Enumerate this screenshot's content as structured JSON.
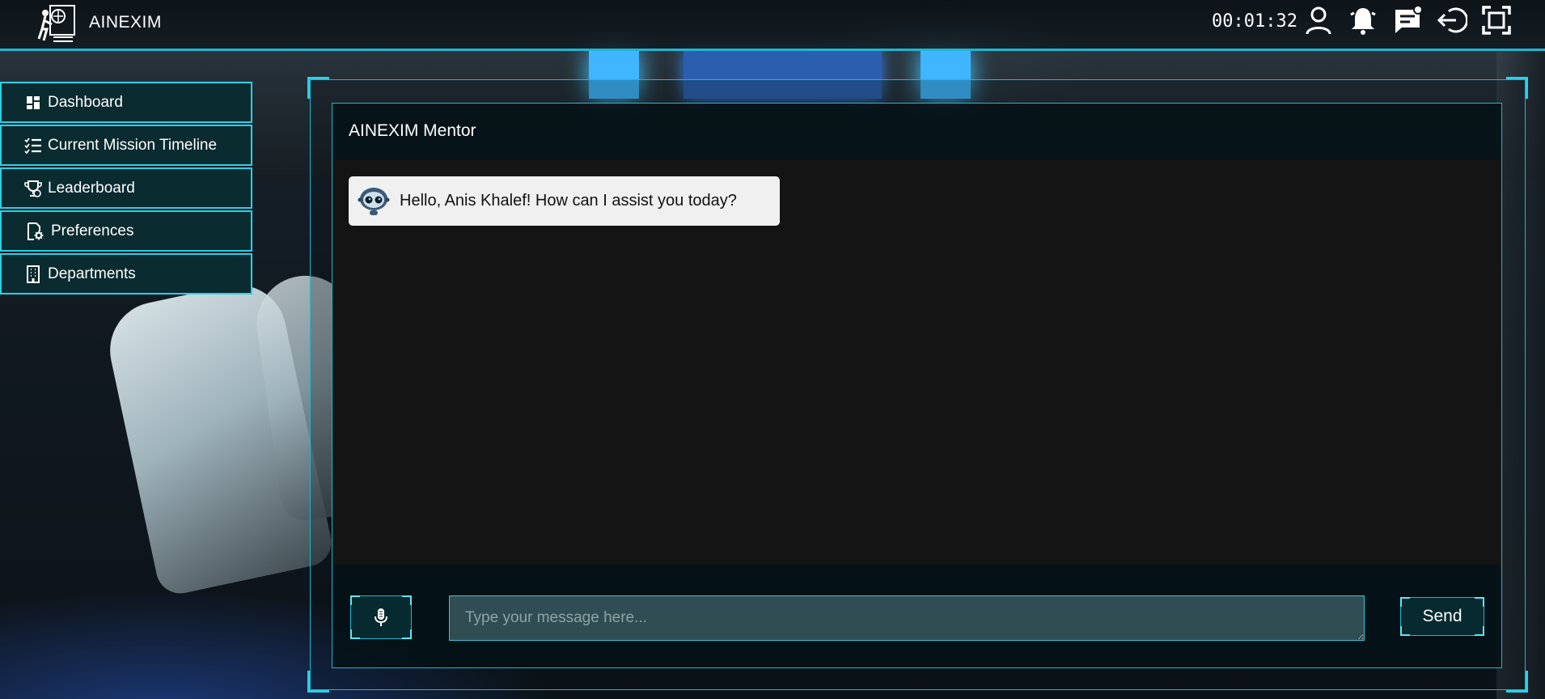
{
  "app": {
    "brand": "AINEXIM",
    "timer": "00:01:32"
  },
  "topbar": {
    "icons": [
      "user-icon",
      "bell-icon",
      "feedback-icon",
      "logout-icon",
      "fullscreen-icon"
    ]
  },
  "sidebar": {
    "items": [
      {
        "label": "Dashboard",
        "icon": "dashboard-icon"
      },
      {
        "label": "Current Mission Timeline",
        "icon": "checklist-icon"
      },
      {
        "label": "Leaderboard",
        "icon": "trophy-icon"
      },
      {
        "label": "Preferences",
        "icon": "settings-file-icon"
      },
      {
        "label": "Departments",
        "icon": "building-icon"
      }
    ]
  },
  "chat": {
    "title": "AINEXIM Mentor",
    "messages": [
      {
        "sender": "bot",
        "text": "Hello, Anis Khalef! How can I assist you today?"
      }
    ],
    "input_placeholder": "Type your message here...",
    "input_value": "",
    "send_label": "Send"
  },
  "colors": {
    "accent": "#1fb6d0",
    "panel": "#0a2b30",
    "chat_bg": "#141414",
    "bubble": "#f0f0f0"
  }
}
